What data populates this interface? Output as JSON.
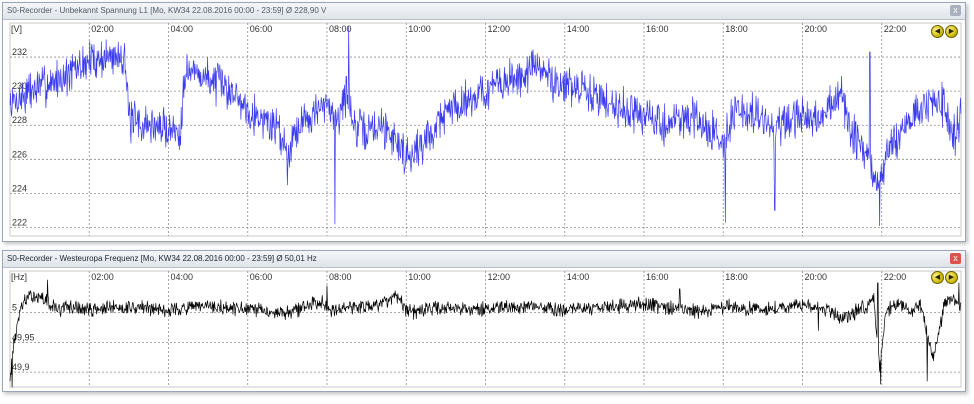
{
  "panels": [
    {
      "title": "S0-Recorder - Unbekannt Spannung L1 [Mo, KW34  22.08.2016 00:00 - 23:59] Ø 228,90 V",
      "close_icon": "close-icon",
      "close_label": "x",
      "nav_prev_label": "◀",
      "nav_next_label": "▶"
    },
    {
      "title": "S0-Recorder - Westeuropa Frequenz [Mo, KW34  22.08.2016 00:00 - 23:59] Ø 50,01 Hz",
      "close_icon": "close-icon",
      "close_label": "x",
      "nav_prev_label": "◀",
      "nav_next_label": "▶"
    }
  ],
  "colors": {
    "voltage_line": "#3a3af0",
    "frequency_line": "#000000",
    "grid": "#8c8c8c"
  },
  "chart_data": [
    {
      "type": "line",
      "title": "S0-Recorder - Unbekannt Spannung L1 [Mo, KW34  22.08.2016 00:00 - 23:59] Ø 228,90 V",
      "ylabel": "[V]",
      "xlim": [
        0,
        24
      ],
      "ylim": [
        221.5,
        234
      ],
      "x_ticks": [
        2,
        4,
        6,
        8,
        10,
        12,
        14,
        16,
        18,
        20,
        22
      ],
      "x_tick_labels": [
        "02:00",
        "04:00",
        "06:00",
        "08:00",
        "10:00",
        "12:00",
        "14:00",
        "16:00",
        "18:00",
        "20:00",
        "22:00"
      ],
      "y_ticks": [
        222,
        224,
        226,
        228,
        230,
        232
      ],
      "y_tick_labels": [
        "222",
        "224",
        "226",
        "228",
        "230",
        "232"
      ],
      "grid": true,
      "legend": "none",
      "series": [
        {
          "x": [
            0,
            0.5,
            1,
            1.5,
            2,
            2.5,
            2.9,
            3.0,
            3.5,
            4.0,
            4.3,
            4.4,
            4.8,
            5.2,
            5.6,
            6.0,
            6.4,
            6.8,
            7.0,
            7.2,
            7.6,
            8.0,
            8.3,
            8.5,
            8.7,
            9.0,
            9.3,
            9.6,
            10.0,
            10.3,
            10.6,
            11.0,
            11.5,
            12.0,
            12.5,
            13.0,
            13.3,
            13.6,
            14.0,
            14.5,
            15.0,
            15.5,
            16.0,
            16.5,
            17.0,
            17.4,
            17.8,
            18.0,
            18.2,
            18.5,
            19.0,
            19.3,
            19.6,
            20.0,
            20.3,
            20.6,
            21.0,
            21.2,
            21.5,
            21.7,
            21.9,
            22.1,
            22.3,
            22.6,
            23.0,
            23.3,
            23.6,
            23.8,
            24.0
          ],
          "y": [
            229.2,
            230.0,
            230.5,
            231.0,
            231.8,
            232.0,
            232.2,
            228.2,
            228.0,
            227.8,
            227.6,
            231.2,
            231.0,
            230.5,
            230.0,
            229.0,
            228.3,
            227.8,
            226.2,
            227.8,
            228.7,
            229.0,
            228.6,
            230.0,
            227.8,
            227.6,
            228.0,
            227.6,
            226.2,
            226.6,
            227.5,
            228.8,
            229.5,
            230.0,
            230.5,
            231.0,
            231.5,
            230.8,
            230.3,
            230.0,
            229.5,
            229.0,
            228.5,
            228.0,
            228.5,
            228.2,
            227.5,
            227.0,
            228.5,
            228.8,
            228.3,
            227.8,
            228.0,
            228.5,
            228.0,
            229.0,
            229.8,
            227.5,
            226.8,
            225.5,
            224.5,
            226.0,
            227.0,
            228.0,
            229.0,
            229.5,
            229.0,
            227.2,
            228.8
          ],
          "noise": 1.8,
          "seed": 7,
          "spikes": [
            {
              "x": 7.0,
              "value": 224.5
            },
            {
              "x": 8.2,
              "value": 222.2
            },
            {
              "x": 8.55,
              "value": 233.8
            },
            {
              "x": 18.05,
              "value": 222.3
            },
            {
              "x": 19.3,
              "value": 223.0
            },
            {
              "x": 21.7,
              "value": 232.3
            },
            {
              "x": 21.95,
              "value": 222.1
            },
            {
              "x": 23.85,
              "value": 226.2
            }
          ]
        }
      ]
    },
    {
      "type": "line",
      "title": "S0-Recorder - Westeuropa Frequenz [Mo, KW34  22.08.2016 00:00 - 23:59] Ø 50,01 Hz",
      "ylabel": "[Hz]",
      "xlim": [
        0,
        24
      ],
      "ylim": [
        49.875,
        50.07
      ],
      "x_ticks": [
        2,
        4,
        6,
        8,
        10,
        12,
        14,
        16,
        18,
        20,
        22
      ],
      "x_tick_labels": [
        "02:00",
        "04:00",
        "06:00",
        "08:00",
        "10:00",
        "12:00",
        "14:00",
        "16:00",
        "18:00",
        "20:00",
        "22:00"
      ],
      "y_ticks": [
        49.9,
        49.95,
        50
      ],
      "y_tick_labels": [
        "49,9",
        "49,95",
        "5"
      ],
      "grid": true,
      "legend": "none",
      "series": [
        {
          "x": [
            0,
            0.1,
            0.3,
            0.6,
            0.9,
            1.2,
            1.5,
            2.0,
            3.0,
            4.0,
            5.0,
            6.0,
            7.0,
            7.9,
            8.1,
            8.5,
            9.0,
            9.8,
            10.0,
            10.5,
            11.0,
            12.0,
            13.0,
            14.0,
            15.0,
            16.0,
            17.0,
            17.5,
            18.0,
            19.0,
            20.0,
            20.6,
            21.0,
            21.6,
            21.8,
            21.95,
            22.1,
            22.4,
            22.7,
            23.0,
            23.3,
            23.6,
            23.8,
            24.0
          ],
          "y": [
            49.89,
            49.95,
            50.015,
            50.03,
            50.02,
            50.005,
            50.01,
            50.005,
            50.01,
            50.005,
            50.01,
            50.005,
            50.0,
            50.02,
            50.005,
            50.01,
            50.01,
            50.025,
            50.0,
            50.005,
            50.01,
            50.005,
            50.01,
            50.005,
            50.01,
            50.015,
            50.005,
            50.0,
            50.01,
            50.005,
            50.015,
            50.005,
            49.99,
            50.01,
            50.025,
            49.91,
            50.0,
            50.015,
            50.005,
            50.01,
            49.92,
            50.02,
            50.025,
            50.01
          ],
          "noise": 0.018,
          "seed": 13,
          "spikes": [
            {
              "x": 0.05,
              "value": 49.875
            },
            {
              "x": 0.95,
              "value": 50.055
            },
            {
              "x": 8.0,
              "value": 50.045
            },
            {
              "x": 16.9,
              "value": 50.04
            },
            {
              "x": 20.4,
              "value": 49.97
            },
            {
              "x": 21.9,
              "value": 50.05
            },
            {
              "x": 21.97,
              "value": 49.88
            },
            {
              "x": 23.15,
              "value": 49.885
            },
            {
              "x": 23.95,
              "value": 50.05
            }
          ]
        }
      ]
    }
  ]
}
